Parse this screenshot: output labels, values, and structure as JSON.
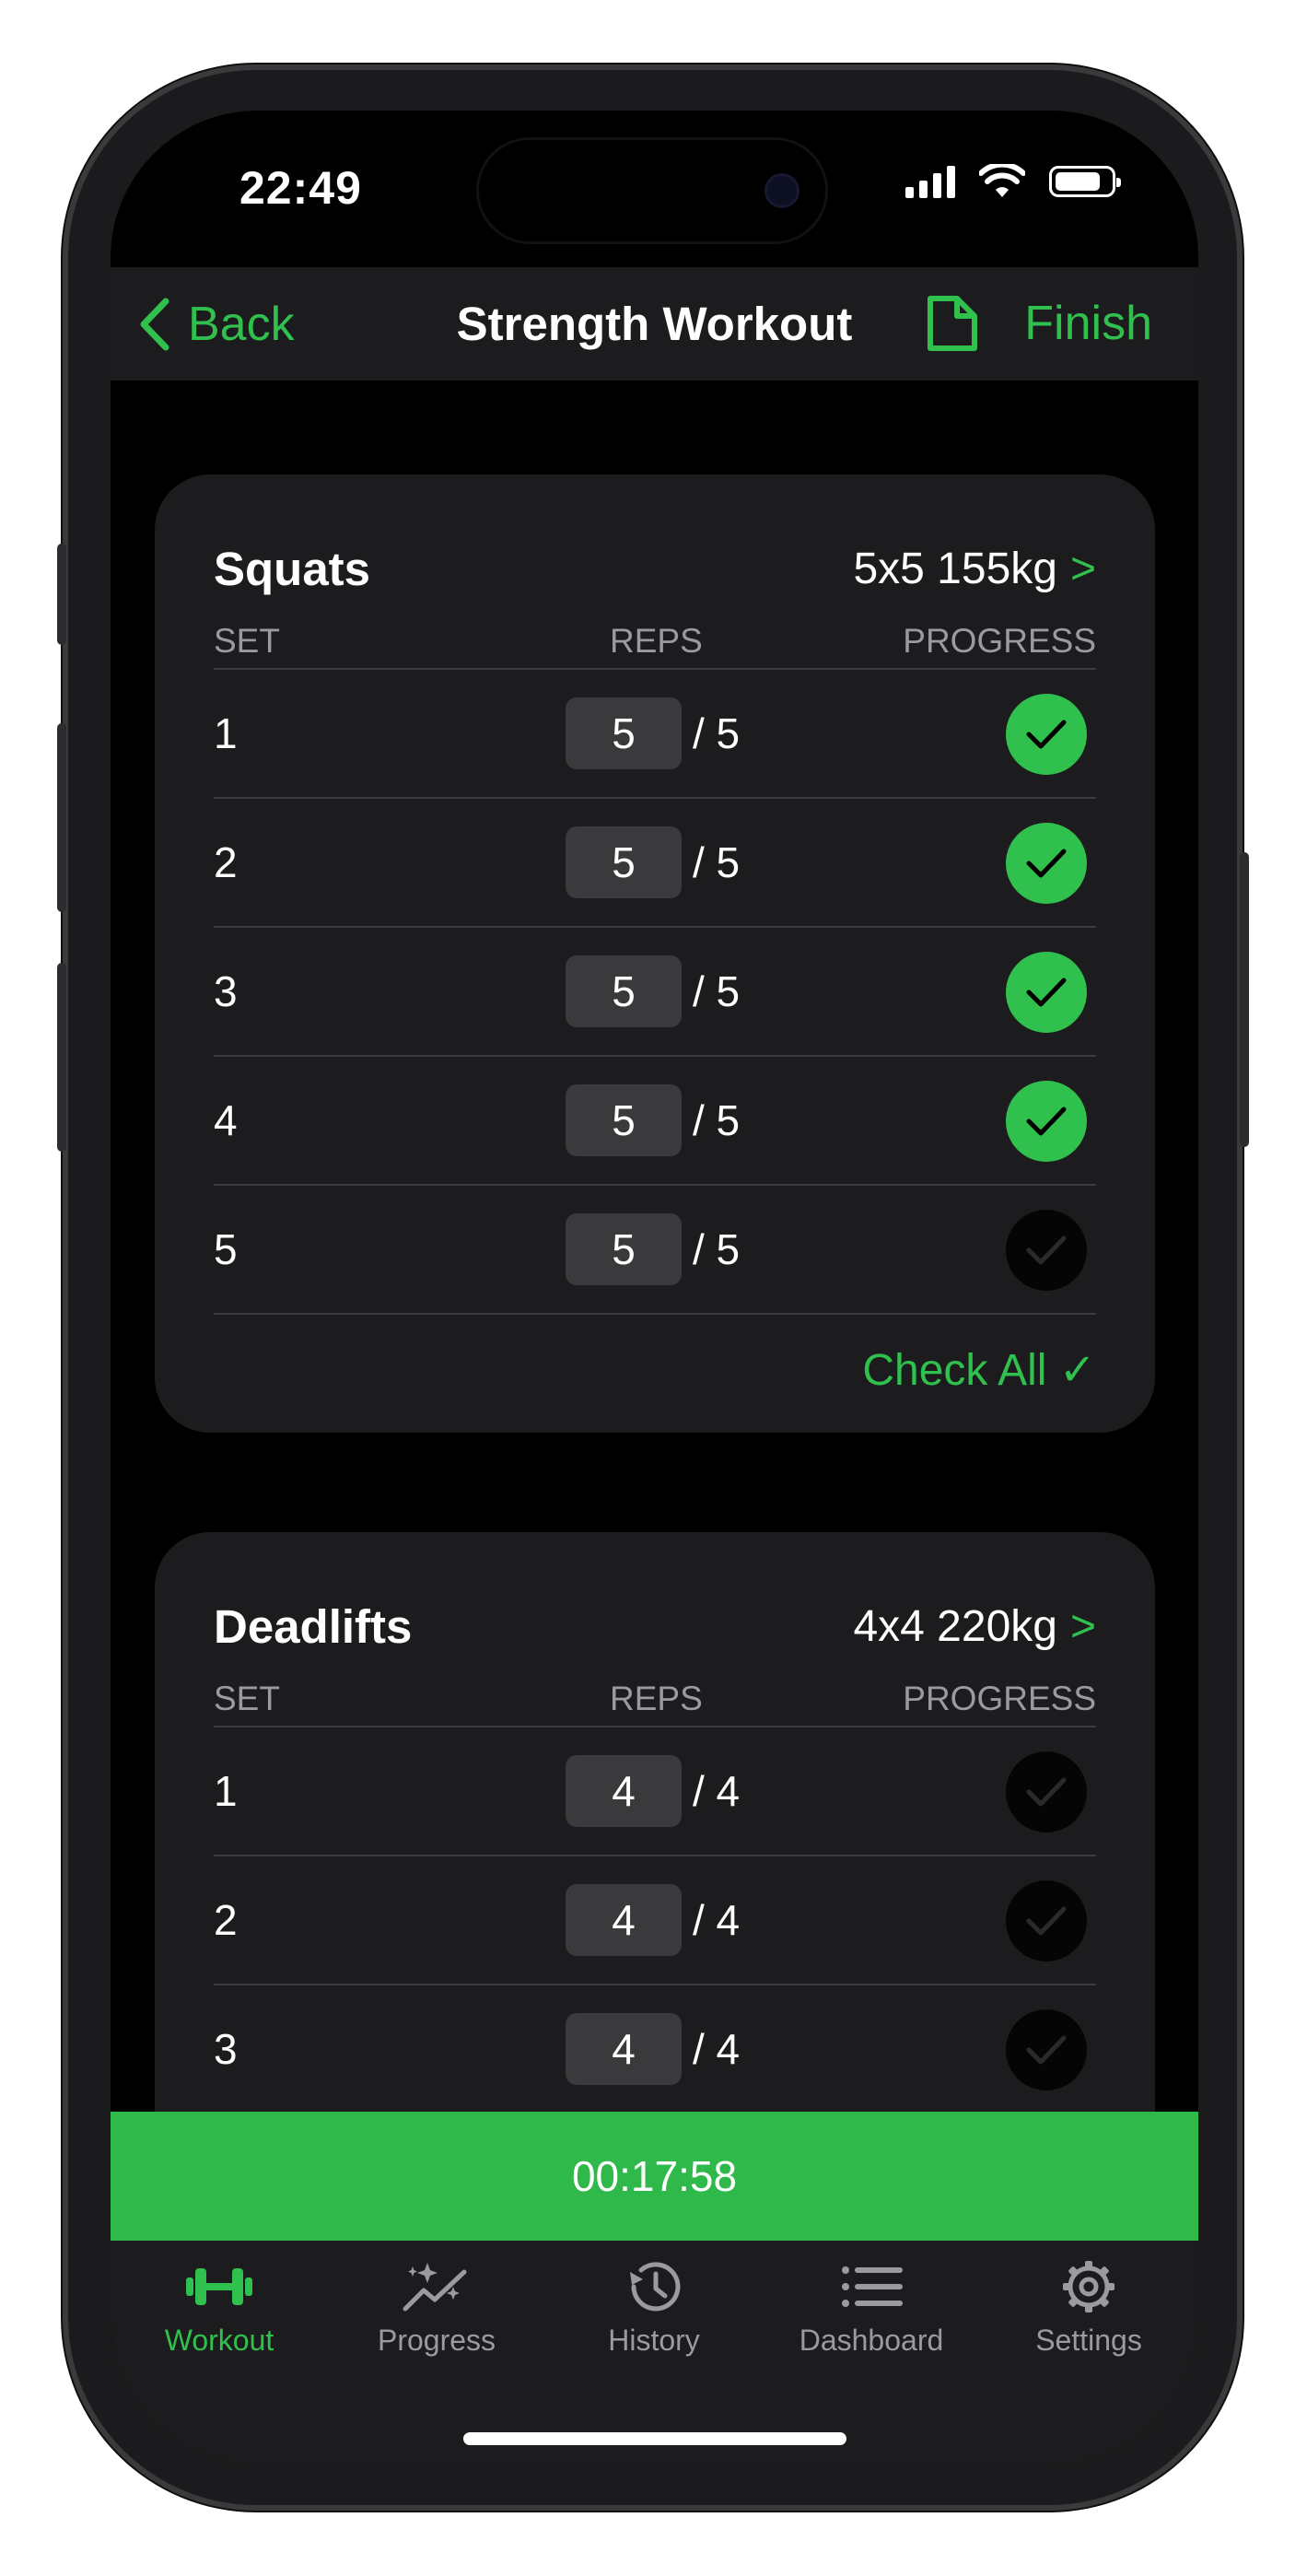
{
  "status": {
    "time": "22:49"
  },
  "nav": {
    "back_label": "Back",
    "title": "Strength Workout",
    "finish_label": "Finish"
  },
  "exercises": [
    {
      "name": "Squats",
      "plan": "5x5 155kg",
      "chevron": ">",
      "columns": {
        "set": "SET",
        "reps": "REPS",
        "progress": "PROGRESS"
      },
      "sets": [
        {
          "set": "1",
          "reps": "5",
          "target": "/ 5",
          "done": true
        },
        {
          "set": "2",
          "reps": "5",
          "target": "/ 5",
          "done": true
        },
        {
          "set": "3",
          "reps": "5",
          "target": "/ 5",
          "done": true
        },
        {
          "set": "4",
          "reps": "5",
          "target": "/ 5",
          "done": true
        },
        {
          "set": "5",
          "reps": "5",
          "target": "/ 5",
          "done": false
        }
      ],
      "check_all": "Check All ✓"
    },
    {
      "name": "Deadlifts",
      "plan": "4x4 220kg",
      "chevron": ">",
      "columns": {
        "set": "SET",
        "reps": "REPS",
        "progress": "PROGRESS"
      },
      "sets": [
        {
          "set": "1",
          "reps": "4",
          "target": "/ 4",
          "done": false
        },
        {
          "set": "2",
          "reps": "4",
          "target": "/ 4",
          "done": false
        },
        {
          "set": "3",
          "reps": "4",
          "target": "/ 4",
          "done": false
        }
      ]
    }
  ],
  "timer": "00:17:58",
  "tabs": [
    {
      "label": "Workout",
      "icon": "dumbbell-icon",
      "active": true
    },
    {
      "label": "Progress",
      "icon": "sparkle-chart-icon",
      "active": false
    },
    {
      "label": "History",
      "icon": "history-icon",
      "active": false
    },
    {
      "label": "Dashboard",
      "icon": "list-icon",
      "active": false
    },
    {
      "label": "Settings",
      "icon": "gear-icon",
      "active": false
    }
  ],
  "colors": {
    "accent": "#30c04e",
    "background": "#000000",
    "card": "#1c1c1e",
    "muted": "#9a9aa0"
  }
}
